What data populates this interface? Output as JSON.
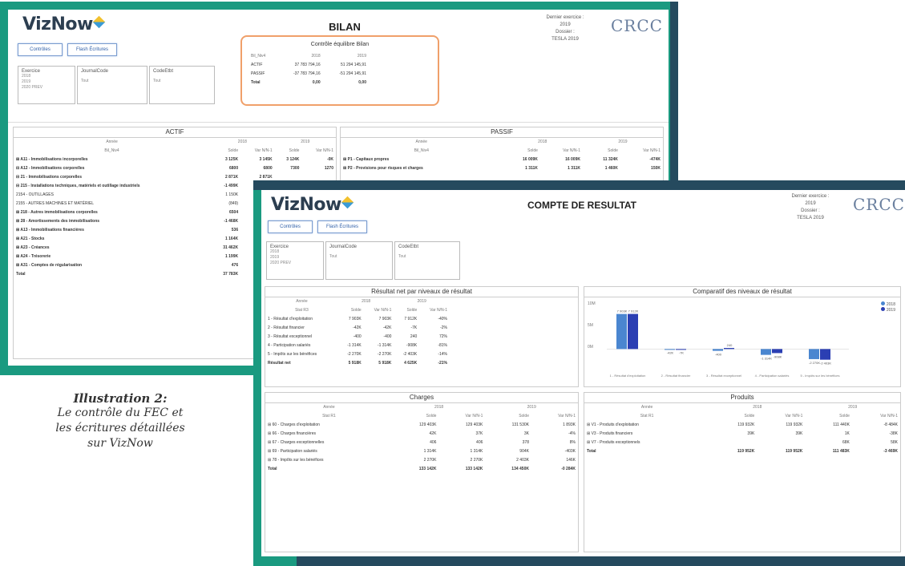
{
  "bilan": {
    "logo": "VizNow",
    "title": "BILAN",
    "buttons": [
      "Contrôles",
      "Flash Écritures"
    ],
    "slicers": [
      {
        "label": "Exercice",
        "items": [
          "2018",
          "2019",
          "2020 PREV"
        ]
      },
      {
        "label": "JournalCode",
        "items": [
          "Tout"
        ]
      },
      {
        "label": "CodeEtbt",
        "items": [
          "Tout"
        ]
      }
    ],
    "meta": {
      "line1": "Dernier exercice :",
      "line2": "2019",
      "line3": "Dossier :",
      "line4": "TESLA 2019"
    },
    "crcc": "CRCC",
    "control": {
      "title": "Contrôle équilibre Bilan",
      "header": [
        "Bil_Niv4",
        "2018",
        "2019"
      ],
      "rows": [
        [
          "ACTIF",
          "37 783 794,16",
          "51 294 145,91"
        ],
        [
          "PASSIF",
          "-37 783 794,16",
          "-51 294 145,91"
        ],
        [
          "Total",
          "0,00",
          "0,00"
        ]
      ]
    },
    "actif": {
      "title": "ACTIF",
      "header1": [
        "Année",
        "2018",
        "2019"
      ],
      "header2": [
        "Bil_Niv4",
        "Solde",
        "Var N/N-1",
        "Solde",
        "Var N/N-1"
      ],
      "rows": [
        {
          "label": "⊞  A11 - Immobilisations incorporelles",
          "v": [
            "3 125K",
            "3 145K",
            "3 124K",
            "-0K"
          ],
          "bold": true
        },
        {
          "label": "⊟  A12 - Immobilisations corporelles",
          "v": [
            "6800",
            "6800",
            "7300",
            "1270"
          ],
          "bold": true
        },
        {
          "label": "    ⊟  21 - Immobilisations corporelles",
          "v": [
            "2 871K",
            "2 871K",
            "",
            ""
          ],
          "bold": true
        },
        {
          "label": "        ⊟  215 - Installations techniques, matériels et outillage industriels",
          "v": [
            "-1 499K",
            "-1 499K",
            "",
            ""
          ],
          "bold": true
        },
        {
          "label": "              2154 - OUTILLAGES",
          "v": [
            "1 150K",
            "",
            "",
            ""
          ],
          "bold": false
        },
        {
          "label": "              2155 - AUTRES MACHINES ET MATÉRIEL",
          "v": [
            "(849)",
            "",
            "",
            ""
          ],
          "bold": false
        },
        {
          "label": "        ⊞  218 - Autres immobilisations corporelles",
          "v": [
            "6504",
            "",
            "",
            ""
          ],
          "bold": true
        },
        {
          "label": "    ⊞  28 - Amortissements des immobilisations",
          "v": [
            "-1 468K",
            "",
            "",
            ""
          ],
          "bold": true
        },
        {
          "label": "⊞  A13 - Immobilisations financières",
          "v": [
            "536",
            "",
            "",
            ""
          ],
          "bold": true
        },
        {
          "label": "⊞  A21 - Stocks",
          "v": [
            "1 164K",
            "",
            "",
            ""
          ],
          "bold": true
        },
        {
          "label": "⊞  A23 - Créances",
          "v": [
            "31 462K",
            "",
            "",
            ""
          ],
          "bold": true
        },
        {
          "label": "⊞  A24 - Trésorerie",
          "v": [
            "1 199K",
            "",
            "",
            ""
          ],
          "bold": true
        },
        {
          "label": "⊞  A31 - Comptes de régularisation",
          "v": [
            "476",
            "",
            "",
            ""
          ],
          "bold": true
        },
        {
          "label": "Total",
          "v": [
            "37 783K",
            "",
            "",
            ""
          ],
          "bold": true
        }
      ]
    },
    "passif": {
      "title": "PASSIF",
      "header1": [
        "Année",
        "2018",
        "2019"
      ],
      "header2": [
        "Bil_Niv4",
        "Solde",
        "Var N/N-1",
        "Solde",
        "Var N/N-1"
      ],
      "rows": [
        {
          "label": "⊞  P1 - Capitaux propres",
          "v": [
            "16 009K",
            "16 009K",
            "11 324K",
            "-474K"
          ],
          "bold": true
        },
        {
          "label": "⊞  P2 - Provisions pour risques et charges",
          "v": [
            "1 311K",
            "1 311K",
            "1 460K",
            "150K"
          ],
          "bold": true
        }
      ]
    }
  },
  "compte": {
    "logo": "VizNow",
    "title": "COMPTE DE RESULTAT",
    "buttons": [
      "Contrôles",
      "Flash Écritures"
    ],
    "slicers": [
      {
        "label": "Exercice",
        "items": [
          "2018",
          "2019",
          "2020 PREV"
        ]
      },
      {
        "label": "JournalCode",
        "items": [
          "Tout"
        ]
      },
      {
        "label": "CodeEtbt",
        "items": [
          "Tout"
        ]
      }
    ],
    "meta": {
      "line1": "Dernier exercice :",
      "line2": "2019",
      "line3": "Dossier :",
      "line4": "TESLA 2019"
    },
    "crcc": "CRCC",
    "resultat": {
      "title": "Résultat net par niveaux de résultat",
      "header1": [
        "Année",
        "2018",
        "2019"
      ],
      "header2": [
        "Stat R3",
        "Solde",
        "Var N/N-1",
        "Solde",
        "Var N/N-1"
      ],
      "rows": [
        {
          "label": "1 - Résultat d'exploitation",
          "v": [
            "7 903K",
            "7 903K",
            "7 912K",
            "-40%"
          ],
          "bold": false
        },
        {
          "label": "2 - Résultat financier",
          "v": [
            "-42K",
            "-42K",
            "-7K",
            "-2%"
          ],
          "bold": false
        },
        {
          "label": "3 - Résultat exceptionnel",
          "v": [
            "-400",
            "-400",
            "240",
            "72%"
          ],
          "bold": false
        },
        {
          "label": "4 - Participation salariés",
          "v": [
            "-1 314K",
            "-1 314K",
            "-908K",
            "-81%"
          ],
          "bold": false
        },
        {
          "label": "5 - Impôts sur les bénéfices",
          "v": [
            "-2 270K",
            "-2 270K",
            "-2 403K",
            "-14%"
          ],
          "bold": false
        },
        {
          "label": "Résultat net",
          "v": [
            "5 918K",
            "5 918K",
            "4 625K",
            "-21%"
          ],
          "bold": true
        }
      ]
    },
    "comparatif": {
      "title": "Comparatif des niveaux de résultat",
      "legend": [
        "2018",
        "2019"
      ],
      "yticks": [
        "10M",
        "5M",
        "0M"
      ]
    },
    "chart_data": {
      "type": "bar",
      "title": "Comparatif des niveaux de résultat",
      "categories": [
        "1 - Résultat d'exploitation",
        "2 - Résultat financier",
        "3 - Résultat exceptionnel",
        "4 - Participation salariés",
        "5 - Impôts sur les bénéfices"
      ],
      "series": [
        {
          "name": "2018",
          "values": [
            7.9,
            -0.04,
            -0.4,
            -1.31,
            -2.27
          ],
          "color": "#4a86d0"
        },
        {
          "name": "2019",
          "values": [
            7.91,
            -0.01,
            0.24,
            -0.91,
            -2.4
          ],
          "color": "#2b3fb3"
        }
      ],
      "data_labels": [
        "7 903K",
        "7 912K",
        "-42K",
        "-7K",
        "-400",
        "240",
        "-1 314K",
        "-908K",
        "-2 270K",
        "-2 403K"
      ],
      "ylim": [
        -3,
        10
      ],
      "legend": "top-right"
    },
    "charges": {
      "title": "Charges",
      "header1": [
        "Année",
        "2018",
        "2019"
      ],
      "header2": [
        "Stat R1",
        "Solde",
        "Var N/N-1",
        "Solde",
        "Var N/N-1"
      ],
      "rows": [
        {
          "label": "⊞  60 - Charges d'exploitation",
          "v": [
            "129 403K",
            "129 403K",
            "131 530K",
            "1 893K"
          ],
          "bold": false
        },
        {
          "label": "⊞  66 - Charges financières",
          "v": [
            "42K",
            "37K",
            "3K",
            "-4%"
          ],
          "bold": false
        },
        {
          "label": "⊞  67 - Charges exceptionnelles",
          "v": [
            "406",
            "406",
            "378",
            "8%"
          ],
          "bold": false
        },
        {
          "label": "⊞  69 - Participation salariés",
          "v": [
            "1 314K",
            "1 314K",
            "904K",
            "-403K"
          ],
          "bold": false
        },
        {
          "label": "⊞  78 - Impôts sur les bénéfices",
          "v": [
            "2 270K",
            "2 270K",
            "2 403K",
            "146K"
          ],
          "bold": false
        },
        {
          "label": "Total",
          "v": [
            "133 142K",
            "133 142K",
            "134 450K",
            "-0 284K"
          ],
          "bold": true
        }
      ]
    },
    "produits": {
      "title": "Produits",
      "header1": [
        "Année",
        "2018",
        "2019"
      ],
      "header2": [
        "Stat R1",
        "Solde",
        "Var N/N-1",
        "Solde",
        "Var N/N-1"
      ],
      "rows": [
        {
          "label": "⊞  V1 - Produits d'exploitation",
          "v": [
            "119 932K",
            "119 932K",
            "111 440K",
            "-8 484K"
          ],
          "bold": false
        },
        {
          "label": "⊞  V3 - Produits financiers",
          "v": [
            "39K",
            "39K",
            "1K",
            "-38K"
          ],
          "bold": false
        },
        {
          "label": "⊞  V7 - Produits exceptionnels",
          "v": [
            "",
            "",
            "68K",
            "58K"
          ],
          "bold": false
        },
        {
          "label": "Total",
          "v": [
            "119 952K",
            "119 952K",
            "111 483K",
            "-3 469K"
          ],
          "bold": true
        }
      ]
    }
  },
  "caption": {
    "title": "Illustration 2:",
    "line1": "Le contrôle du FEC et",
    "line2": "les écritures détaillées",
    "line3": "sur VizNow"
  }
}
